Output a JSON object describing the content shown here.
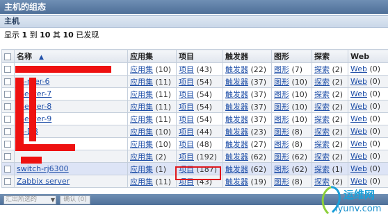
{
  "window": {
    "title": "主机的组态"
  },
  "section": {
    "title": "主机"
  },
  "summary": {
    "prefix": "显示",
    "from": "1",
    "to_word": "到",
    "to": "10",
    "of_word": "其",
    "total": "10",
    "suffix": "已发现"
  },
  "columns": {
    "name": "名称",
    "applications": "应用集",
    "items": "项目",
    "triggers": "触发器",
    "graphs": "图形",
    "discovery": "探索",
    "web": "Web"
  },
  "rows": [
    {
      "name": "",
      "app": "应用集",
      "app_n": "(10)",
      "item": "项目",
      "item_n": "(43)",
      "trig": "触发器",
      "trig_n": "(22)",
      "graph": "图形",
      "graph_n": "(7)",
      "disc": "探索",
      "disc_n": "(2)",
      "web": "Web",
      "web_n": "(0)"
    },
    {
      "name": "-S-rver-6",
      "app": "应用集",
      "app_n": "(11)",
      "item": "项目",
      "item_n": "(54)",
      "trig": "触发器",
      "trig_n": "(37)",
      "graph": "图形",
      "graph_n": "(10)",
      "disc": "探索",
      "disc_n": "(2)",
      "web": "Web",
      "web_n": "(0)"
    },
    {
      "name": "-Server-7",
      "app": "应用集",
      "app_n": "(11)",
      "item": "项目",
      "item_n": "(54)",
      "trig": "触发器",
      "trig_n": "(37)",
      "graph": "图形",
      "graph_n": "(10)",
      "disc": "探索",
      "disc_n": "(2)",
      "web": "Web",
      "web_n": "(0)"
    },
    {
      "name": "-Server-8",
      "app": "应用集",
      "app_n": "(11)",
      "item": "项目",
      "item_n": "(54)",
      "trig": "触发器",
      "trig_n": "(37)",
      "graph": "图形",
      "graph_n": "(10)",
      "disc": "探索",
      "disc_n": "(2)",
      "web": "Web",
      "web_n": "(0)"
    },
    {
      "name": "-Server-9",
      "app": "应用集",
      "app_n": "(11)",
      "item": "项目",
      "item_n": "(54)",
      "trig": "触发器",
      "trig_n": "(37)",
      "graph": "图形",
      "graph_n": "(10)",
      "disc": "探索",
      "disc_n": "(2)",
      "web": "Web",
      "web_n": "(0)"
    },
    {
      "name": "-S-DB",
      "app": "应用集",
      "app_n": "(10)",
      "item": "项目",
      "item_n": "(44)",
      "trig": "触发器",
      "trig_n": "(23)",
      "graph": "图形",
      "graph_n": "(8)",
      "disc": "探索",
      "disc_n": "(2)",
      "web": "Web",
      "web_n": "(0)"
    },
    {
      "name": "-8",
      "app": "应用集",
      "app_n": "(10)",
      "item": "项目",
      "item_n": "(48)",
      "trig": "触发器",
      "trig_n": "(27)",
      "graph": "图形",
      "graph_n": "(8)",
      "disc": "探索",
      "disc_n": "(2)",
      "web": "Web",
      "web_n": "(0)"
    },
    {
      "name": "",
      "app": "应用集",
      "app_n": "(2)",
      "item": "项目",
      "item_n": "(192)",
      "trig": "触发器",
      "trig_n": "(62)",
      "graph": "图形",
      "graph_n": "(62)",
      "disc": "探索",
      "disc_n": "(2)",
      "web": "Web",
      "web_n": "(0)"
    },
    {
      "name": "switch-rj6300",
      "app": "应用集",
      "app_n": "(1)",
      "item": "项目",
      "item_n": "(187)",
      "trig": "触发器",
      "trig_n": "(62)",
      "graph": "图形",
      "graph_n": "(62)",
      "disc": "探索",
      "disc_n": "(1)",
      "web": "Web",
      "web_n": "(0)"
    },
    {
      "name": "Zabbix server",
      "app": "应用集",
      "app_n": "(11)",
      "item": "项目",
      "item_n": "(43)",
      "trig": "触发器",
      "trig_n": "(19)",
      "graph": "图形",
      "graph_n": "(8)",
      "disc": "探索",
      "disc_n": "(2)",
      "web": "Web",
      "web_n": "(0)"
    }
  ],
  "footer": {
    "mass_select": "汇出所选的",
    "apply": "确认 (0)"
  },
  "watermark": {
    "brand": "运维网",
    "url": "iyunv.com"
  },
  "colors": {
    "link": "#1f4fa8",
    "header": "#4e6f98",
    "highlight_box": "#e0181e",
    "redaction": "#ee1111"
  }
}
